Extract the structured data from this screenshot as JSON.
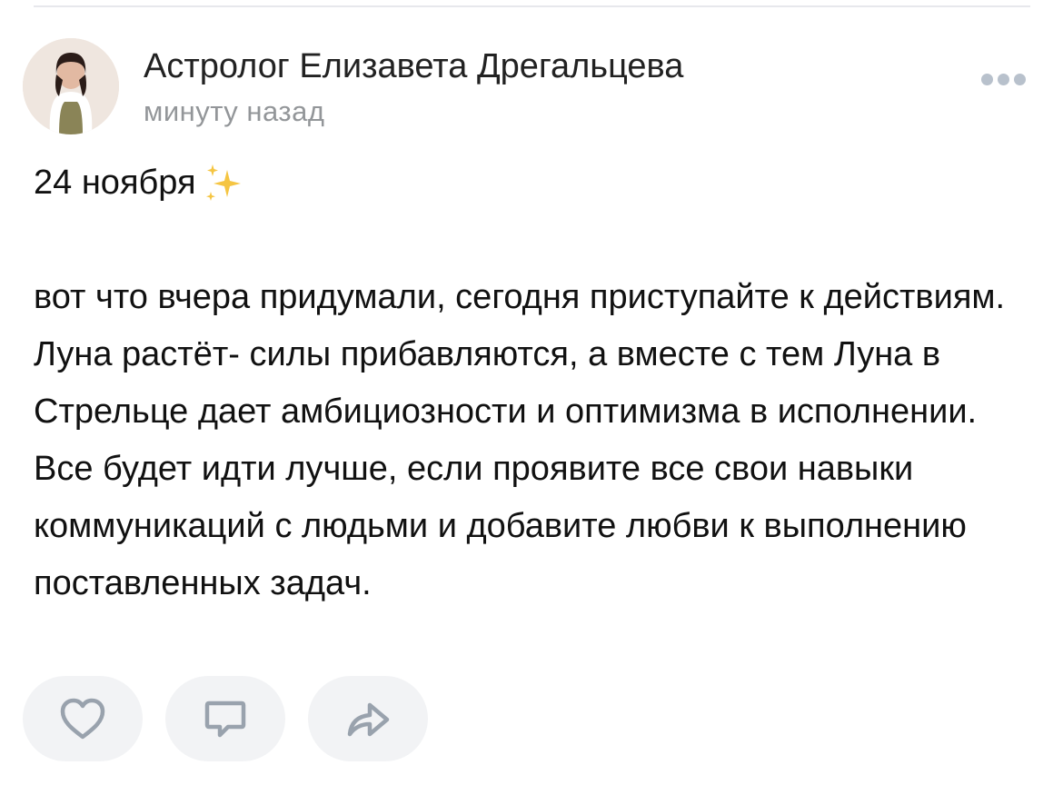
{
  "post": {
    "author_name": "Астролог Елизавета Дрегальцева",
    "time": "минуту назад",
    "date_line": "24 ноября",
    "text": "вот что вчера придумали, сегодня приступайте к действиям. Луна растёт- силы прибавляются, а вместе с тем Луна в Стрельце дает амбициозности и оптимизма в исполнении. Все будет идти лучше, если проявите все свои навыки коммуникаций с людьми и добавите любви к выполнению поставленных задач."
  },
  "icons": {
    "more": "more-dots-icon",
    "sparkle": "sparkles-icon",
    "like": "heart-icon",
    "comment": "comment-icon",
    "share": "share-icon"
  },
  "colors": {
    "text": "#111111",
    "secondary_text": "#939699",
    "icon": "#99a2ad",
    "button_bg": "#f2f3f5",
    "sparkle": "#f5c542"
  }
}
